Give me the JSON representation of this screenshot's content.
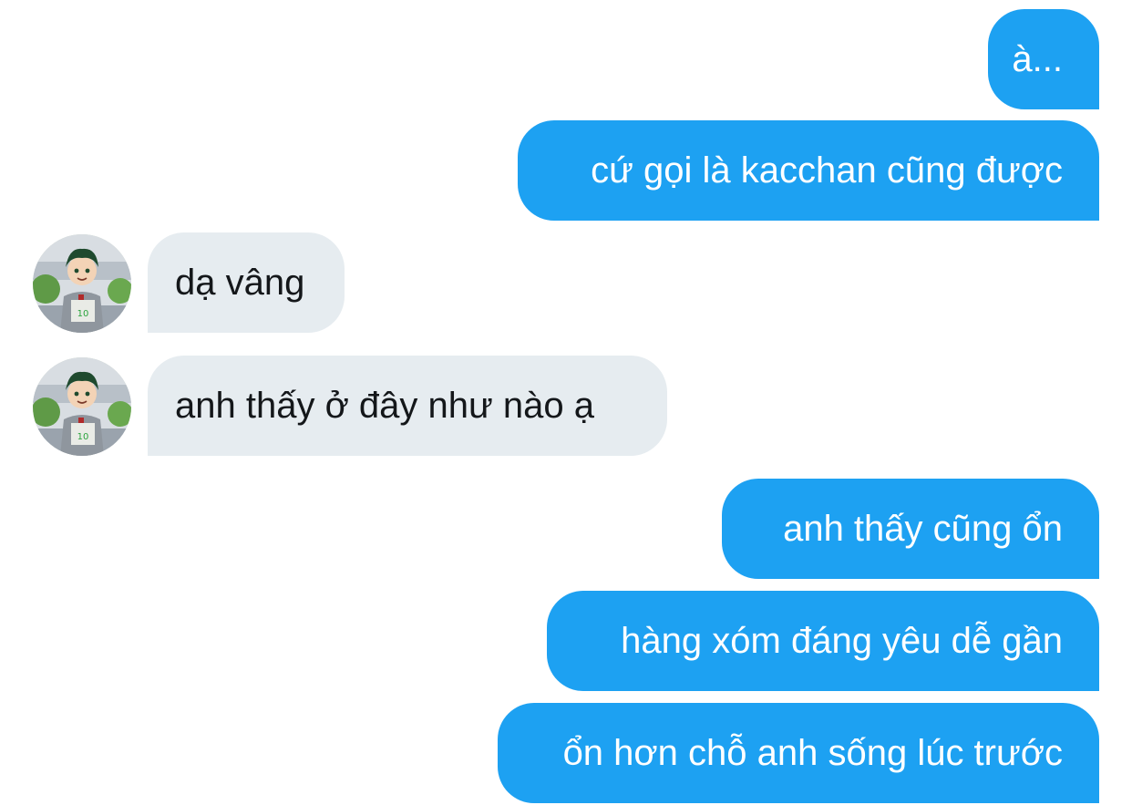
{
  "conversation": {
    "messages": [
      {
        "from": "me",
        "text": "à..."
      },
      {
        "from": "me",
        "text": "cứ gọi là kacchan cũng được"
      },
      {
        "from": "them",
        "text": "dạ vâng"
      },
      {
        "from": "them",
        "text": "anh thấy ở đây như nào ạ"
      },
      {
        "from": "me",
        "text": "anh thấy cũng ổn"
      },
      {
        "from": "me",
        "text": "hàng xóm đáng yêu dễ gần"
      },
      {
        "from": "me",
        "text": "ổn hơn chỗ anh sống lúc trước"
      }
    ]
  },
  "avatar": {
    "icon": "contact-avatar-icon"
  },
  "colors": {
    "outgoing_bubble": "#1da1f2",
    "outgoing_text": "#ffffff",
    "incoming_bubble": "#e6ecf0",
    "incoming_text": "#14171a"
  }
}
